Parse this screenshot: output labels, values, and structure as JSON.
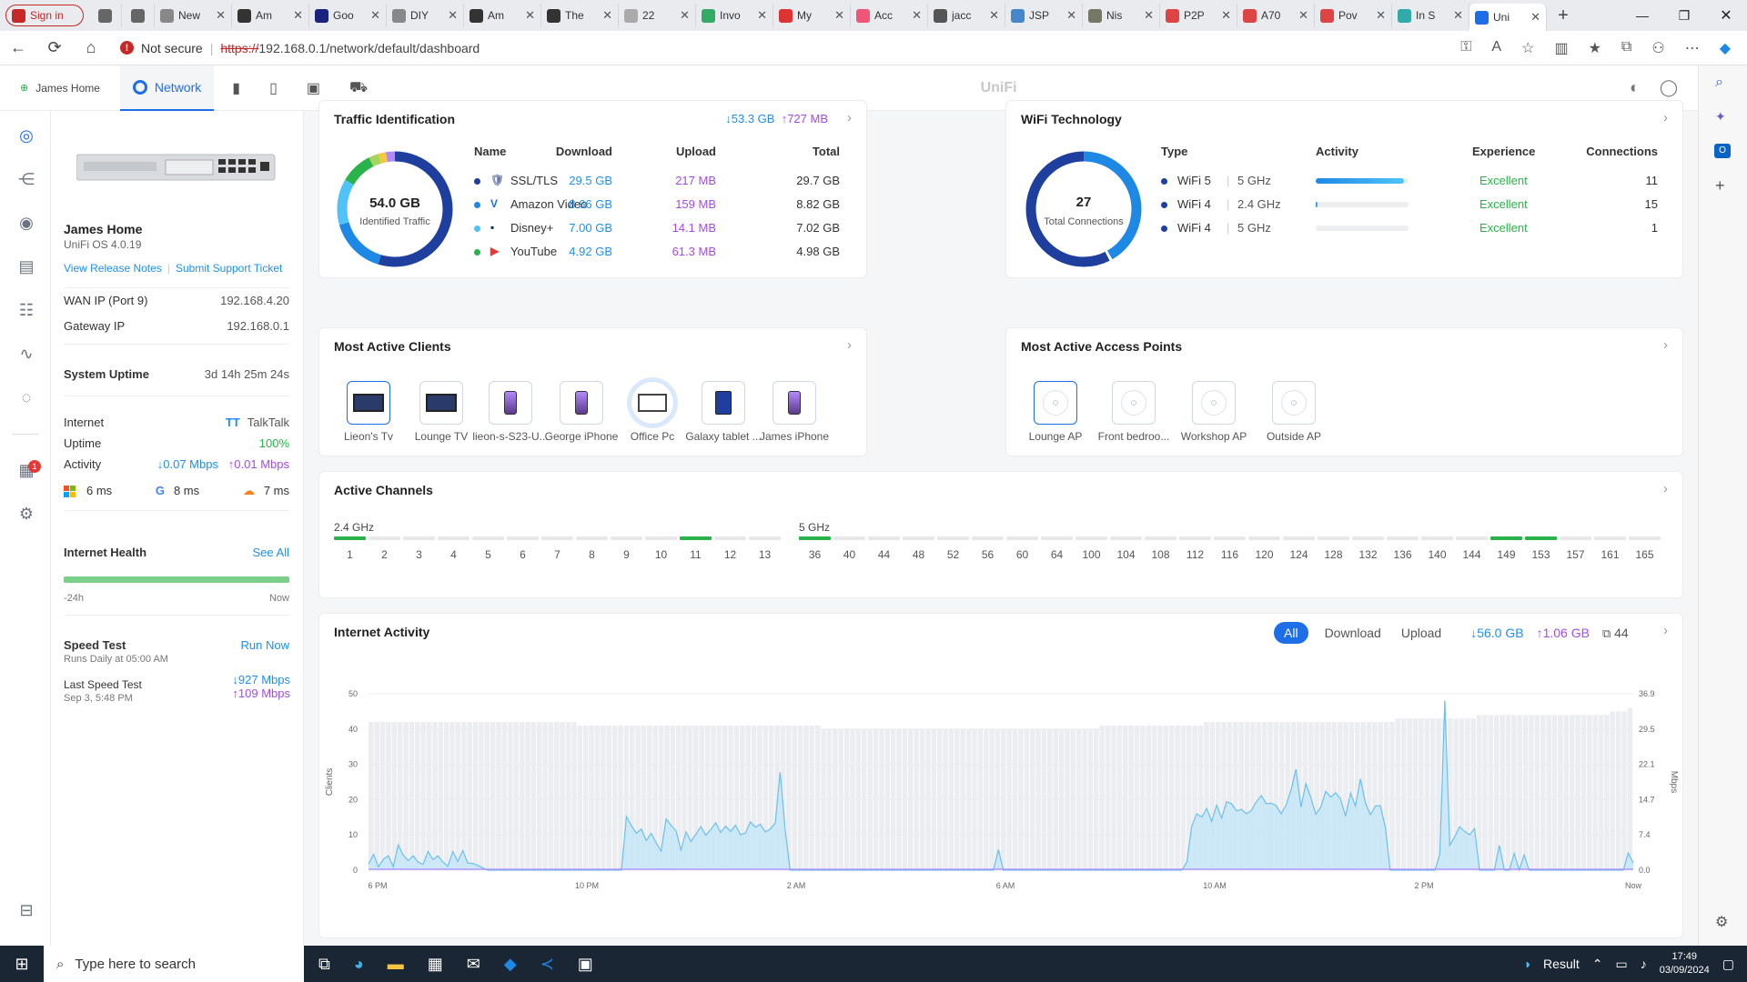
{
  "browser": {
    "tabs": [
      {
        "label": "Sign in",
        "color": "#c62828"
      },
      {
        "label": "",
        "color": "#666"
      },
      {
        "label": "",
        "color": "#666"
      },
      {
        "label": "New",
        "color": "#888"
      },
      {
        "label": "Am",
        "color": "#333"
      },
      {
        "label": "Goo",
        "color": "#1a237e"
      },
      {
        "label": "DIY",
        "color": "#888"
      },
      {
        "label": "Am",
        "color": "#333"
      },
      {
        "label": "The",
        "color": "#333"
      },
      {
        "label": "22",
        "color": "#aaa"
      },
      {
        "label": "Invo",
        "color": "#3a6"
      },
      {
        "label": "My",
        "color": "#d33"
      },
      {
        "label": "Acc",
        "color": "#e57"
      },
      {
        "label": "jacc",
        "color": "#555"
      },
      {
        "label": "JSP",
        "color": "#48c"
      },
      {
        "label": "Nis",
        "color": "#776"
      },
      {
        "label": "P2P",
        "color": "#d44"
      },
      {
        "label": "A70",
        "color": "#d44"
      },
      {
        "label": "Pov",
        "color": "#d44"
      },
      {
        "label": "In S",
        "color": "#3aa"
      },
      {
        "label": "Uni",
        "color": "#1e6ee8"
      }
    ],
    "not_secure": "Not secure",
    "url_scheme": "https://",
    "url_rest": "192.168.0.1/network/default/dashboard"
  },
  "header": {
    "site": "James Home",
    "network": "Network",
    "brand": "UniFi"
  },
  "device": {
    "name": "James Home",
    "os": "UniFi OS 4.0.19",
    "release_notes": "View Release Notes",
    "support": "Submit Support Ticket",
    "wan_label": "WAN IP (Port 9)",
    "wan_value": "192.168.4.20",
    "gw_label": "Gateway IP",
    "gw_value": "192.168.0.1",
    "uptime_label": "System Uptime",
    "uptime_value": "3d 14h 25m 24s",
    "internet_label": "Internet",
    "isp": "TalkTalk",
    "isp_logo": "TT",
    "uptime2_label": "Uptime",
    "uptime2_value": "100%",
    "activity_label": "Activity",
    "act_down": "0.07 Mbps",
    "act_up": "0.01 Mbps",
    "lat1": "6 ms",
    "lat2": "8 ms",
    "lat3": "7 ms",
    "health_label": "Internet Health",
    "see_all": "See All",
    "health_start": "-24h",
    "health_end": "Now",
    "speed_label": "Speed Test",
    "run_now": "Run Now",
    "speed_sched": "Runs Daily at 05:00 AM",
    "last_label": "Last Speed Test",
    "last_date": "Sep 3, 5:48 PM",
    "last_down": "927 Mbps",
    "last_up": "109 Mbps",
    "badge": "1"
  },
  "traffic": {
    "title": "Traffic Identification",
    "total_down": "53.3 GB",
    "total_up": "727 MB",
    "donut_value": "54.0 GB",
    "donut_label": "Identified Traffic",
    "headers": [
      "Name",
      "Download",
      "Upload",
      "Total"
    ],
    "rows": [
      {
        "name": "SSL/TLS",
        "dl": "29.5 GB",
        "ul": "217 MB",
        "total": "29.7 GB",
        "dot": "#1f3f9e"
      },
      {
        "name": "Amazon Video",
        "dl": "8.66 GB",
        "ul": "159 MB",
        "total": "8.82 GB",
        "dot": "#1e88e5"
      },
      {
        "name": "Disney+",
        "dl": "7.00 GB",
        "ul": "14.1 MB",
        "total": "7.02 GB",
        "dot": "#4fc3f7"
      },
      {
        "name": "YouTube",
        "dl": "4.92 GB",
        "ul": "61.3 MB",
        "total": "4.98 GB",
        "dot": "#2ab34a"
      }
    ]
  },
  "wifi": {
    "title": "WiFi Technology",
    "donut_value": "27",
    "donut_label": "Total Connections",
    "headers": [
      "Type",
      "Activity",
      "Experience",
      "Connections"
    ],
    "rows": [
      {
        "type": "WiFi 5",
        "band": "5 GHz",
        "activity": 0.95,
        "exp": "Excellent",
        "conn": "11"
      },
      {
        "type": "WiFi 4",
        "band": "2.4 GHz",
        "activity": 0.02,
        "exp": "Excellent",
        "conn": "15"
      },
      {
        "type": "WiFi 4",
        "band": "5 GHz",
        "activity": 0.0,
        "exp": "Excellent",
        "conn": "1"
      }
    ]
  },
  "clients": {
    "title": "Most Active Clients",
    "items": [
      "Lieon's Tv",
      "Lounge TV",
      "lieon-s-S23-U...",
      "George iPhone",
      "Office Pc",
      "Galaxy tablet ...",
      "James iPhone"
    ]
  },
  "aps": {
    "title": "Most Active Access Points",
    "items": [
      "Lounge AP",
      "Front bedroo...",
      "Workshop AP",
      "Outside AP"
    ]
  },
  "channels": {
    "title": "Active Channels",
    "band24": "2.4 GHz",
    "band5": "5 GHz",
    "ch24": [
      "1",
      "2",
      "3",
      "4",
      "5",
      "6",
      "7",
      "8",
      "9",
      "10",
      "11",
      "12",
      "13"
    ],
    "ch24_on": [
      "1",
      "11"
    ],
    "ch5": [
      "36",
      "40",
      "44",
      "48",
      "52",
      "56",
      "60",
      "64",
      "100",
      "104",
      "108",
      "112",
      "116",
      "120",
      "124",
      "128",
      "132",
      "136",
      "140",
      "144",
      "149",
      "153",
      "157",
      "161",
      "165"
    ],
    "ch5_on": [
      "36",
      "149",
      "153"
    ]
  },
  "activity": {
    "title": "Internet Activity",
    "filters": [
      "All",
      "Download",
      "Upload"
    ],
    "down": "56.0 GB",
    "up": "1.06 GB",
    "clients": "44",
    "y_left_label": "Clients",
    "y_right_label": "Mbps",
    "y_left": [
      "50",
      "40",
      "30",
      "20",
      "10",
      "0"
    ],
    "y_right": [
      "36.9",
      "29.5",
      "22.1",
      "14.7",
      "7.4",
      "0.0"
    ],
    "x": [
      "6 PM",
      "10 PM",
      "2 AM",
      "6 AM",
      "10 AM",
      "2 PM",
      "Now"
    ]
  },
  "chart_data": {
    "type": "area",
    "title": "Internet Activity",
    "xlabel": "",
    "ylabel": "Clients",
    "ylabel_right": "Mbps",
    "x_ticks": [
      "6 PM",
      "10 PM",
      "2 AM",
      "6 AM",
      "10 AM",
      "2 PM",
      "Now"
    ],
    "ylim": [
      0,
      50
    ],
    "ylim_right": [
      0,
      36.9
    ],
    "series": [
      {
        "values": [
          42,
          42,
          42,
          42,
          42,
          42,
          42,
          42,
          42,
          42,
          42,
          42,
          42,
          42,
          42,
          42,
          42,
          42,
          42,
          42,
          42,
          42,
          42,
          42,
          42,
          42,
          42,
          42,
          42,
          42,
          42,
          42,
          42,
          42,
          42,
          42,
          41,
          41,
          41,
          41,
          41,
          41,
          41,
          41,
          41,
          41,
          41,
          41,
          41,
          41,
          41,
          41,
          41,
          41,
          41,
          41,
          41,
          41,
          41,
          41,
          41,
          41,
          41,
          41,
          41,
          41,
          41,
          41,
          41,
          41,
          41,
          41,
          41,
          41,
          41,
          41,
          41,
          41,
          40,
          40,
          40,
          40,
          40,
          40,
          40,
          40,
          40,
          40,
          40,
          40,
          40,
          40,
          40,
          40,
          40,
          40,
          40,
          40,
          40,
          40,
          40,
          40,
          40,
          40,
          40,
          40,
          40,
          40,
          40,
          40,
          40,
          40,
          40,
          40,
          40,
          40,
          40,
          40,
          40,
          40,
          40,
          40,
          40,
          40,
          40,
          40,
          41,
          41,
          41,
          41,
          41,
          41,
          41,
          41,
          41,
          41,
          41,
          41,
          41,
          41,
          41,
          41,
          41,
          41,
          42,
          42,
          42,
          42,
          42,
          42,
          42,
          42,
          42,
          42,
          42,
          42,
          42,
          42,
          42,
          42,
          42,
          42,
          42,
          42,
          42,
          42,
          42,
          42,
          42,
          42,
          42,
          42,
          42,
          42,
          42,
          42,
          42,
          43,
          43,
          43,
          43,
          43,
          43,
          43,
          43,
          43,
          43,
          43,
          43,
          43,
          43,
          44,
          44,
          44,
          44,
          44,
          44,
          44,
          44,
          44,
          44,
          44,
          44,
          44,
          44,
          44,
          44,
          44,
          44,
          44,
          44,
          44,
          44,
          44,
          45,
          45,
          45,
          46
        ]
      },
      {
        "values": [
          1.3,
          3.3,
          0.7,
          2.3,
          3,
          0.7,
          5.3,
          3.1,
          2,
          3,
          1.7,
          1.2,
          3.9,
          2.2,
          3,
          1.7,
          0.8,
          3.9,
          1.8,
          4.1,
          1.5,
          1.4,
          1,
          0.5,
          0,
          0,
          0,
          0,
          0,
          0,
          0,
          0,
          0,
          0,
          0,
          0,
          0,
          0,
          0,
          0,
          0,
          0,
          0,
          0,
          0,
          0,
          0,
          0,
          0,
          0,
          0,
          0,
          11.2,
          9.3,
          7.7,
          8.6,
          6.2,
          7.7,
          5.7,
          4,
          10.7,
          9.4,
          8.2,
          4.2,
          8,
          6,
          7.5,
          9.1,
          7.3,
          8.5,
          9.9,
          7.9,
          9.2,
          8.1,
          9.4,
          7.4,
          7.8,
          10.1,
          9,
          9.6,
          8,
          8.6,
          9.9,
          20.5,
          8.5,
          0,
          0,
          0,
          0,
          0,
          0,
          0,
          0,
          0,
          0,
          0,
          0,
          0,
          0,
          0,
          0,
          0,
          0,
          0,
          0,
          0,
          0,
          0,
          0,
          0,
          0,
          0,
          0,
          0,
          0,
          0,
          0,
          0,
          0,
          0,
          0,
          0,
          0,
          0,
          0,
          0,
          0,
          4.3,
          0,
          0,
          0,
          0,
          0,
          0,
          0,
          0,
          0,
          0,
          0,
          0,
          0,
          0,
          0,
          0,
          0,
          0,
          0,
          0,
          0,
          0,
          0,
          0,
          0,
          0,
          0,
          0,
          0,
          0,
          0,
          0,
          0,
          0,
          0,
          0,
          0,
          1.7,
          9.3,
          11.8,
          11.1,
          12.9,
          10.2,
          13.6,
          10.9,
          14.3,
          13.9,
          12.4,
          12.7,
          11.8,
          12.5,
          14.3,
          15.6,
          13.9,
          14,
          13.5,
          11.8,
          13.6,
          16.8,
          21.1,
          13.2,
          18.1,
          15.1,
          11.7,
          13.2,
          16.5,
          15.3,
          16.2,
          14.8,
          11.3,
          16.1,
          13.4,
          19.1,
          14.1,
          11.6,
          13.4,
          13.5,
          9,
          0,
          0,
          0,
          0,
          0,
          0,
          0,
          0,
          0,
          0,
          3.3,
          35.5,
          5.2,
          7,
          9.1,
          8.1,
          7.4,
          8.7,
          0,
          0,
          0,
          0,
          5.2,
          0,
          0,
          3.5,
          0,
          3.2,
          0,
          0,
          0,
          0,
          0,
          0,
          0,
          0,
          0,
          0,
          0,
          0,
          0,
          0,
          0,
          0,
          0,
          0,
          0,
          0,
          3.6,
          1.5
        ]
      }
    ]
  }
}
